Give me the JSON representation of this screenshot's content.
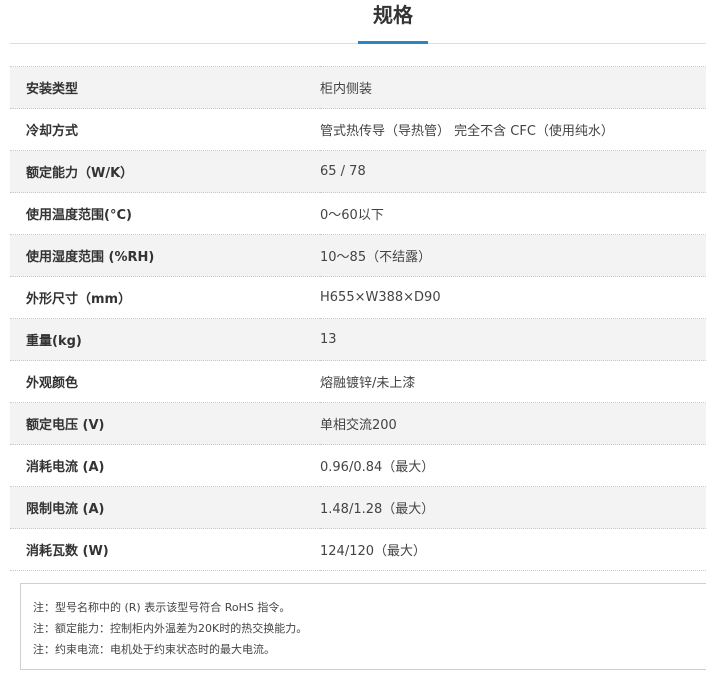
{
  "page": {
    "title": "规格"
  },
  "specs": [
    {
      "label": "安装类型",
      "value": "柜内侧装"
    },
    {
      "label": "冷却方式",
      "value": "管式热传导（导热管） 完全不含 CFC（使用纯水）"
    },
    {
      "label": "额定能力（W/K）",
      "value": "65 / 78"
    },
    {
      "label": "使用温度范围(°C)",
      "value": "0～60以下"
    },
    {
      "label": "使用湿度范围 (%RH)",
      "value": "10～85（不结露）"
    },
    {
      "label": "外形尺寸（mm）",
      "value": "H655×W388×D90"
    },
    {
      "label": "重量(kg)",
      "value": "13"
    },
    {
      "label": "外观颜色",
      "value": "熔融镀锌/未上漆"
    },
    {
      "label": "额定电压 (V)",
      "value": "单相交流200"
    },
    {
      "label": "消耗电流 (A)",
      "value": "0.96/0.84（最大）"
    },
    {
      "label": "限制电流 (A)",
      "value": "1.48/1.28（最大）"
    },
    {
      "label": "消耗瓦数 (W)",
      "value": "124/120（最大）"
    }
  ],
  "notes": [
    "注：型号名称中的 (R) 表示该型号符合 RoHS 指令。",
    "注：额定能力：控制柜内外温差为20K时的热交换能力。",
    "注：约束电流：电机处于约束状态时的最大电流。"
  ],
  "colors": {
    "accent": "#2a86c9",
    "row_shade": "#f3f3f3"
  }
}
